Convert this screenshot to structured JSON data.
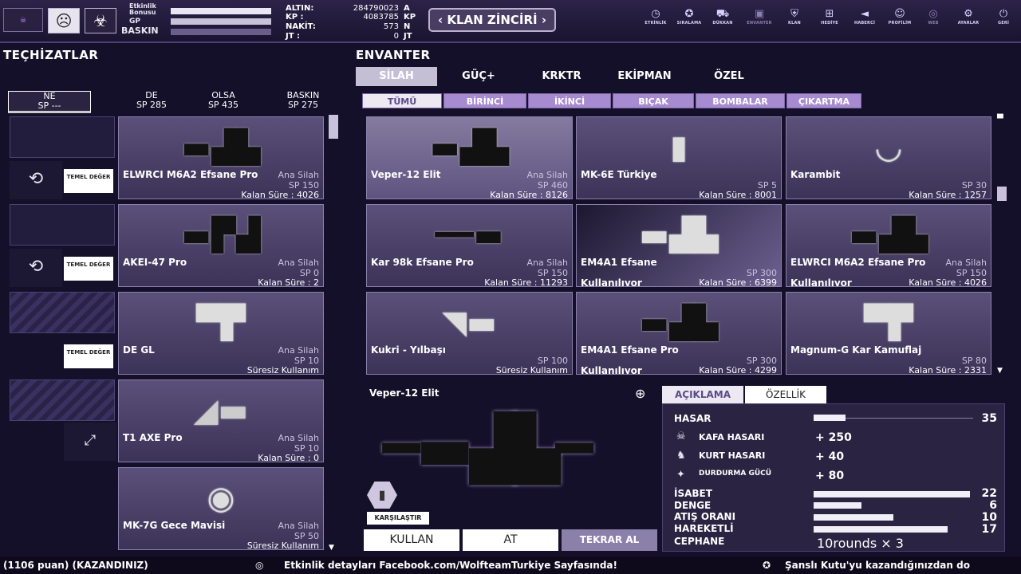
{
  "topbar": {
    "stats": {
      "etkinlik": "Etkinlik Bonusu",
      "gp": "GP",
      "baskin": "BASKIN"
    },
    "money": [
      {
        "label": "ALTIN:",
        "value": "284790023",
        "unit": "A"
      },
      {
        "label": "KP :",
        "value": "4083785",
        "unit": "KP"
      },
      {
        "label": "NAKİT:",
        "value": "573",
        "unit": "N"
      },
      {
        "label": "JT :",
        "value": "0",
        "unit": "JT"
      }
    ],
    "klan_button": "KLAN ZİNCİRİ",
    "nav": [
      {
        "label": "ETKİNLİK",
        "icon": "clock-icon"
      },
      {
        "label": "SIRALAMA",
        "icon": "medal-icon"
      },
      {
        "label": "DÜKKAN",
        "icon": "cart-icon"
      },
      {
        "label": "ENVANTER",
        "icon": "box-icon"
      },
      {
        "label": "KLAN",
        "icon": "shield-icon"
      },
      {
        "label": "HEDİYE",
        "icon": "gift-icon"
      },
      {
        "label": "HABERCİ",
        "icon": "megaphone-icon"
      },
      {
        "label": "PROFİLİM",
        "icon": "person-icon"
      },
      {
        "label": "WEB",
        "icon": "globe-icon"
      },
      {
        "label": "AYARLAR",
        "icon": "gear-icon"
      },
      {
        "label": "GERİ",
        "icon": "power-icon"
      }
    ]
  },
  "left": {
    "title": "TEÇHİZATLAR",
    "headers": [
      {
        "name": "NE",
        "sp": "SP ---"
      },
      {
        "name": "DE",
        "sp": "SP 285"
      },
      {
        "name": "OLSA",
        "sp": "SP 435"
      },
      {
        "name": "BASKIN",
        "sp": "SP 275"
      }
    ],
    "temel": "TEMEL DEĞER",
    "items": [
      {
        "name": "ELWRCI M6A2 Efsane Pro",
        "type": "Ana Silah",
        "sp": "SP 150",
        "kalan": "Kalan Süre : 4026",
        "icon": "rifle-icon"
      },
      {
        "name": "AKEI-47 Pro",
        "type": "Ana Silah",
        "sp": "SP 0",
        "kalan": "Kalan Süre : 2",
        "icon": "ak-rifle-icon"
      },
      {
        "name": "DE GL",
        "type": "Ana Silah",
        "sp": "SP 10",
        "kalan": "Süresiz Kullanım",
        "icon": "pistol-icon"
      },
      {
        "name": "T1 AXE Pro",
        "type": "Ana Silah",
        "sp": "SP 10",
        "kalan": "Kalan Süre : 0",
        "icon": "axe-icon"
      },
      {
        "name": "MK-7G Gece Mavisi",
        "type": "Ana Silah",
        "sp": "SP 50",
        "kalan": "Süresiz Kullanım",
        "icon": "grenade-icon"
      }
    ]
  },
  "inventory": {
    "title": "ENVANTER",
    "tabs": [
      "SİLAH",
      "GÜÇ+",
      "KRKTR",
      "EKİPMAN",
      "ÖZEL"
    ],
    "subtabs": [
      "TÜMÜ",
      "BİRİNCİ",
      "İKİNCİ",
      "BIÇAK",
      "BOMBALAR",
      "ÇIKARTMA"
    ],
    "items": [
      {
        "name": "Veper-12 Elit",
        "type": "Ana Silah",
        "sp": "SP 460",
        "kalan": "Kalan Süre : 8126",
        "status": ""
      },
      {
        "name": "MK-6E Türkiye",
        "type": "",
        "sp": "SP 5",
        "kalan": "Kalan Süre : 8001",
        "status": ""
      },
      {
        "name": "Karambit",
        "type": "",
        "sp": "SP 30",
        "kalan": "Kalan Süre : 1257",
        "status": ""
      },
      {
        "name": "Kar 98k Efsane Pro",
        "type": "Ana Silah",
        "sp": "SP 150",
        "kalan": "Kalan Süre : 11293",
        "status": ""
      },
      {
        "name": "EM4A1 Efsane",
        "type": "",
        "sp": "SP 300",
        "kalan": "Kalan Süre : 6399",
        "status": "Kullanılıyor"
      },
      {
        "name": "ELWRCI M6A2 Efsane Pro",
        "type": "Ana Silah",
        "sp": "SP 150",
        "kalan": "Kalan Süre : 4026",
        "status": "Kullanılıyor"
      },
      {
        "name": "Kukri - Yılbaşı",
        "type": "",
        "sp": "SP 100",
        "kalan": "Süresiz Kullanım",
        "status": ""
      },
      {
        "name": "EM4A1 Efsane Pro",
        "type": "",
        "sp": "SP 300",
        "kalan": "Kalan Süre : 4299",
        "status": "Kullanılıyor"
      },
      {
        "name": "Magnum-G Kar Kamuflaj",
        "type": "",
        "sp": "SP 80",
        "kalan": "Kalan Süre : 2331",
        "status": ""
      }
    ]
  },
  "detail": {
    "name": "Veper-12 Elit",
    "compare": "KARŞILAŞTIR",
    "tabs": [
      "AÇIKLAMA",
      "ÖZELLİK"
    ],
    "hasar": {
      "label": "HASAR",
      "value": "35",
      "fill": 0.2
    },
    "sub": [
      {
        "label": "KAFA HASARI",
        "value": "+ 250",
        "icon": "skull-icon"
      },
      {
        "label": "KURT HASARI",
        "value": "+ 40",
        "icon": "wolf-icon"
      },
      {
        "label": "DURDURMA GÜCÜ",
        "value": "+ 80",
        "icon": "runner-icon"
      }
    ],
    "stats": [
      {
        "label": "İSABET",
        "value": "22",
        "fill": 0.98
      },
      {
        "label": "DENGE",
        "value": "6",
        "fill": 0.3
      },
      {
        "label": "ATIŞ ORANI",
        "value": "10",
        "fill": 0.5
      },
      {
        "label": "HAREKETLİ",
        "value": "17",
        "fill": 0.84
      }
    ],
    "cephane": {
      "label": "CEPHANE",
      "value": "10rounds × 3"
    },
    "buttons": [
      "KULLAN",
      "AT",
      "TEKRAR AL"
    ]
  },
  "footer": {
    "left": "(1106 puan) (KAZANDINIZ)",
    "mid": "Etkinlik detayları Facebook.com/WolfteamTurkiye Sayfasında!",
    "right": "Şanslı Kutu'yu kazandığınızdan do"
  },
  "colors": {
    "accent": "#a78bd0",
    "bg": "#15102a"
  }
}
